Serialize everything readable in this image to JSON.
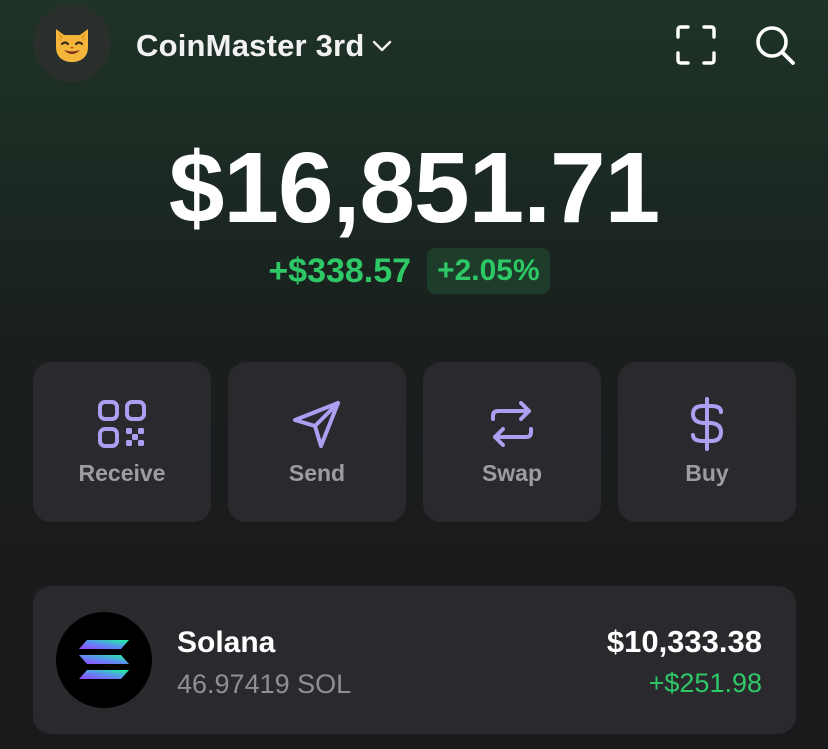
{
  "header": {
    "avatar_icon": "cat-face-icon",
    "account_name": "CoinMaster 3rd",
    "switcher_icon": "chevron-down-icon",
    "scan_icon": "scan-frame-icon",
    "search_icon": "search-icon"
  },
  "portfolio": {
    "balance": "$16,851.71",
    "change_amount": "+$338.57",
    "change_percent": "+2.05%"
  },
  "actions": [
    {
      "label": "Receive",
      "icon": "qr-code-icon"
    },
    {
      "label": "Send",
      "icon": "paper-plane-icon"
    },
    {
      "label": "Swap",
      "icon": "swap-arrows-icon"
    },
    {
      "label": "Buy",
      "icon": "dollar-icon"
    }
  ],
  "tokens": [
    {
      "name": "Solana",
      "amount": "46.97419 SOL",
      "value": "$10,333.38",
      "change": "+$251.98",
      "icon": "solana-logo-icon"
    }
  ],
  "colors": {
    "accent_purple": "#ab9ff2",
    "positive_green": "#2ec866",
    "card_bg": "#2a2a2e",
    "muted_text": "#8e8e93"
  }
}
